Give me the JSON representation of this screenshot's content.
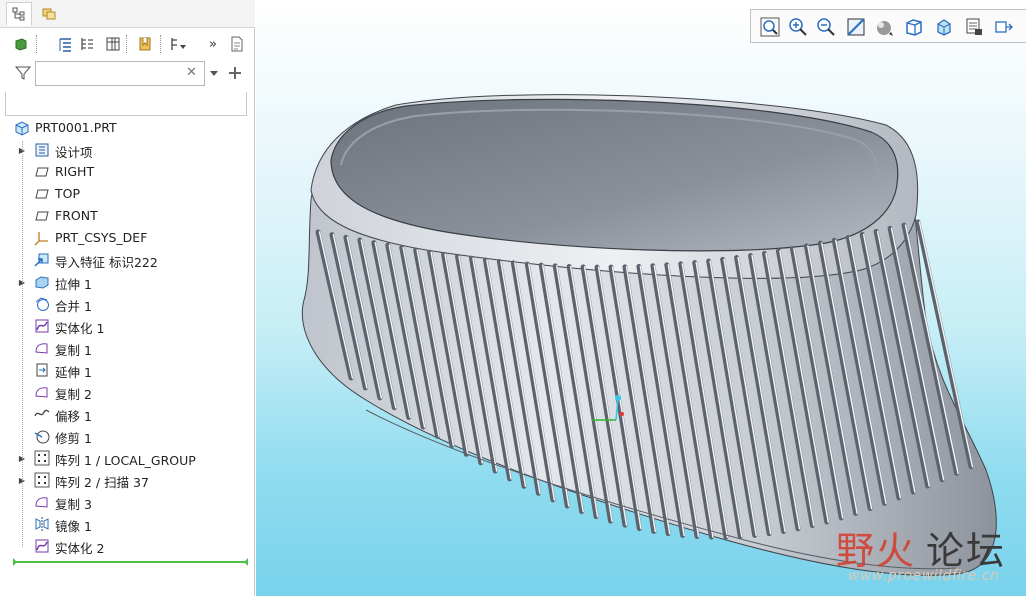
{
  "model_tree": {
    "filter": {
      "value": "",
      "placeholder": ""
    },
    "root": "PRT0001.PRT",
    "items": [
      {
        "label": "设计项",
        "icon": "layers-icon",
        "expandable": true
      },
      {
        "label": "RIGHT",
        "icon": "datum-plane-icon",
        "expandable": false
      },
      {
        "label": "TOP",
        "icon": "datum-plane-icon",
        "expandable": false
      },
      {
        "label": "FRONT",
        "icon": "datum-plane-icon",
        "expandable": false
      },
      {
        "label": "PRT_CSYS_DEF",
        "icon": "csys-icon",
        "expandable": false
      },
      {
        "label": "导入特征 标识222",
        "icon": "import-icon",
        "expandable": false
      },
      {
        "label": "拉伸 1",
        "icon": "extrude-icon",
        "expandable": true
      },
      {
        "label": "合并 1",
        "icon": "merge-icon",
        "expandable": false
      },
      {
        "label": "实体化 1",
        "icon": "solidify-icon",
        "expandable": false
      },
      {
        "label": "复制 1",
        "icon": "copy-icon",
        "expandable": false
      },
      {
        "label": "延伸 1",
        "icon": "extend-icon",
        "expandable": false
      },
      {
        "label": "复制 2",
        "icon": "copy-icon",
        "expandable": false
      },
      {
        "label": "偏移 1",
        "icon": "offset-icon",
        "expandable": false
      },
      {
        "label": "修剪 1",
        "icon": "trim-icon",
        "expandable": false
      },
      {
        "label": "阵列 1 / LOCAL_GROUP",
        "icon": "pattern-icon",
        "expandable": true
      },
      {
        "label": "阵列 2 / 扫描 37",
        "icon": "pattern-icon",
        "expandable": true
      },
      {
        "label": "复制 3",
        "icon": "copy-icon",
        "expandable": false
      },
      {
        "label": "镜像 1",
        "icon": "mirror-icon",
        "expandable": false
      },
      {
        "label": "实体化 2",
        "icon": "solidify-icon",
        "expandable": false
      }
    ]
  },
  "toolbar": {
    "more": "»"
  },
  "watermark": {
    "text_red": "野火",
    "text_dark": "论坛",
    "url": "www.proewildfire.cn"
  },
  "colors": {
    "accent_green": "#4fc046",
    "model_fill": "#9aa1ac",
    "bg_bottom": "#78d2ec"
  }
}
